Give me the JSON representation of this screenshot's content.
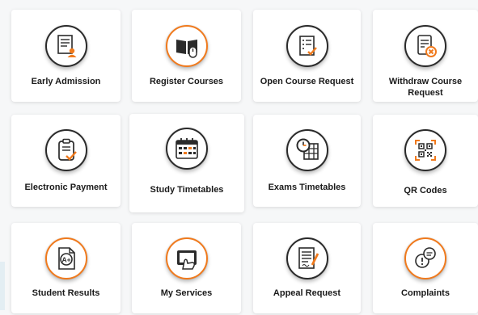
{
  "tiles": [
    {
      "label": "Early Admission",
      "icon": "admission-form-icon"
    },
    {
      "label": "Register Courses",
      "icon": "book-mouse-icon"
    },
    {
      "label": "Open Course Request",
      "icon": "checklist-icon"
    },
    {
      "label": "Withdraw Course Request",
      "icon": "withdraw-document-icon"
    },
    {
      "label": "Electronic Payment",
      "icon": "clipboard-check-icon"
    },
    {
      "label": "Study Timetables",
      "icon": "calendar-icon"
    },
    {
      "label": "Exams Timetables",
      "icon": "clock-calendar-icon"
    },
    {
      "label": "QR Codes",
      "icon": "qr-code-icon"
    },
    {
      "label": "Student Results",
      "icon": "grade-a-plus-icon"
    },
    {
      "label": "My Services",
      "icon": "tablet-hand-icon"
    },
    {
      "label": "Appeal Request",
      "icon": "document-pen-icon"
    },
    {
      "label": "Complaints",
      "icon": "speech-bubble-icon"
    }
  ],
  "colors": {
    "accent": "#f07a1d",
    "text": "#1a1a1a",
    "background": "#f6f7f8",
    "card": "#ffffff"
  }
}
